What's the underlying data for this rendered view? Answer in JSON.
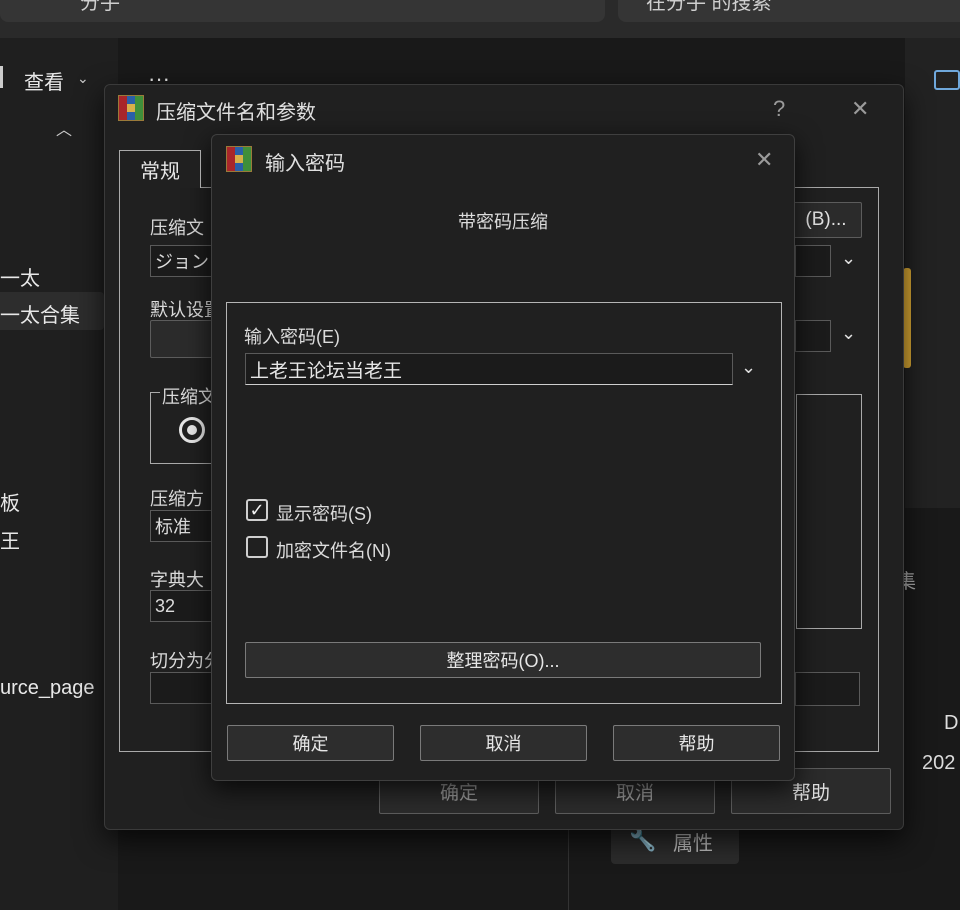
{
  "background": {
    "tab1_text": "分手",
    "tab2_text": "在分手 的搜索",
    "view_menu": "查看",
    "more_dots": "···",
    "nav_items": [
      "一太",
      "一太合集",
      "板",
      "王",
      "urce_page"
    ],
    "side_text": "集",
    "right_text_1": "D:",
    "right_text_2": "202",
    "properties_button": "属性"
  },
  "dialog_archive": {
    "title": "压缩文件名和参数",
    "help_symbol": "?",
    "close_symbol": "✕",
    "tab_general": "常规",
    "archive_name_label": "压缩文",
    "archive_name_value": "ジョン",
    "browse_button": "(B)...",
    "default_settings_label": "默认设置",
    "archive_format_group": "压缩文",
    "compression_method_label": "压缩方",
    "compression_method_value": "标准",
    "dictionary_label": "字典大",
    "dictionary_value": "32",
    "split_label": "切分为分",
    "ok_button": "确定",
    "cancel_button": "取消",
    "help_button": "帮助"
  },
  "dialog_password": {
    "title": "输入密码",
    "close_symbol": "✕",
    "heading": "带密码压缩",
    "password_label": "输入密码(E)",
    "password_value": "上老王论坛当老王",
    "show_password_label": "显示密码(S)",
    "show_password_checked": true,
    "encrypt_names_label": "加密文件名(N)",
    "encrypt_names_checked": false,
    "organize_button": "整理密码(O)...",
    "ok_button": "确定",
    "cancel_button": "取消",
    "help_button": "帮助",
    "check_mark": "✓"
  }
}
